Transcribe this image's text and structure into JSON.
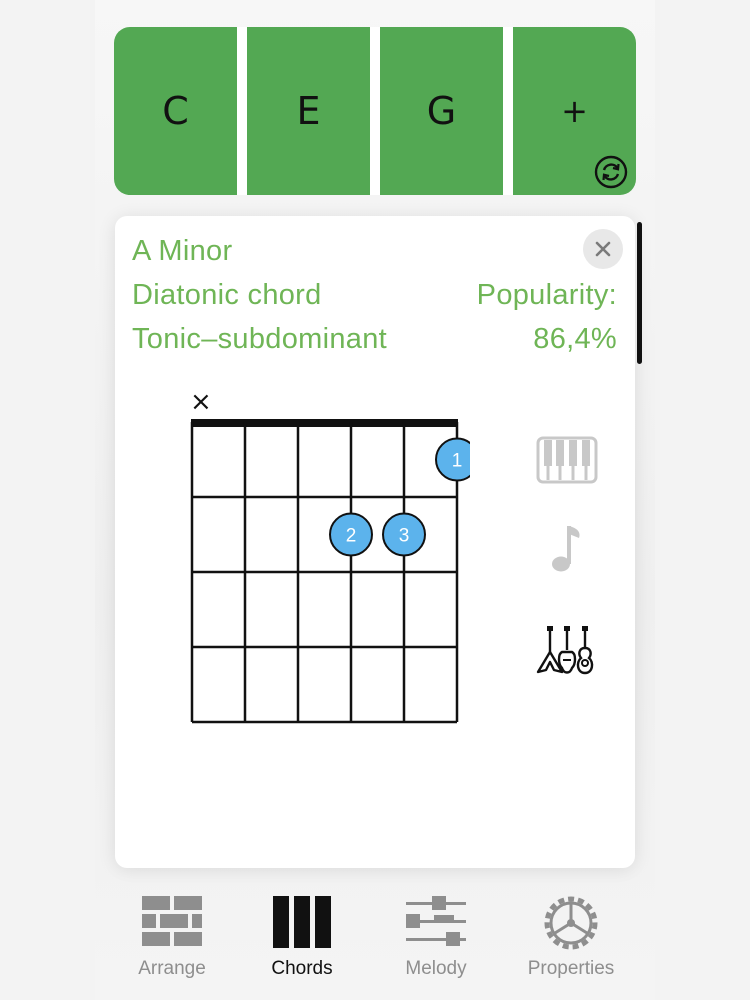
{
  "notes": [
    {
      "label": "C"
    },
    {
      "label": "E"
    },
    {
      "label": "G"
    },
    {
      "label": "+"
    }
  ],
  "chord_info": {
    "name": "A Minor",
    "type": "Diatonic chord",
    "function": "Tonic–subdominant",
    "popularity_label": "Popularity:",
    "popularity_value": "86,4%"
  },
  "fretboard": {
    "muted_marker": "×",
    "fingers": [
      {
        "label": "1",
        "string": 5,
        "fret": 1
      },
      {
        "label": "2",
        "string": 3,
        "fret": 2
      },
      {
        "label": "3",
        "string": 4,
        "fret": 2
      }
    ]
  },
  "side_modes": [
    {
      "icon": "piano-icon",
      "active": false
    },
    {
      "icon": "music-note-icon",
      "active": false
    },
    {
      "icon": "guitars-icon",
      "active": true
    }
  ],
  "tabs": [
    {
      "label": "Arrange",
      "icon": "bricks-icon",
      "active": false
    },
    {
      "label": "Chords",
      "icon": "chords-icon",
      "active": true
    },
    {
      "label": "Melody",
      "icon": "sliders-icon",
      "active": false
    },
    {
      "label": "Properties",
      "icon": "gear-wheel-icon",
      "active": false
    }
  ],
  "colors": {
    "tile_green": "#53a853",
    "info_green": "#6fb556",
    "dot_blue": "#5cb3ec"
  }
}
